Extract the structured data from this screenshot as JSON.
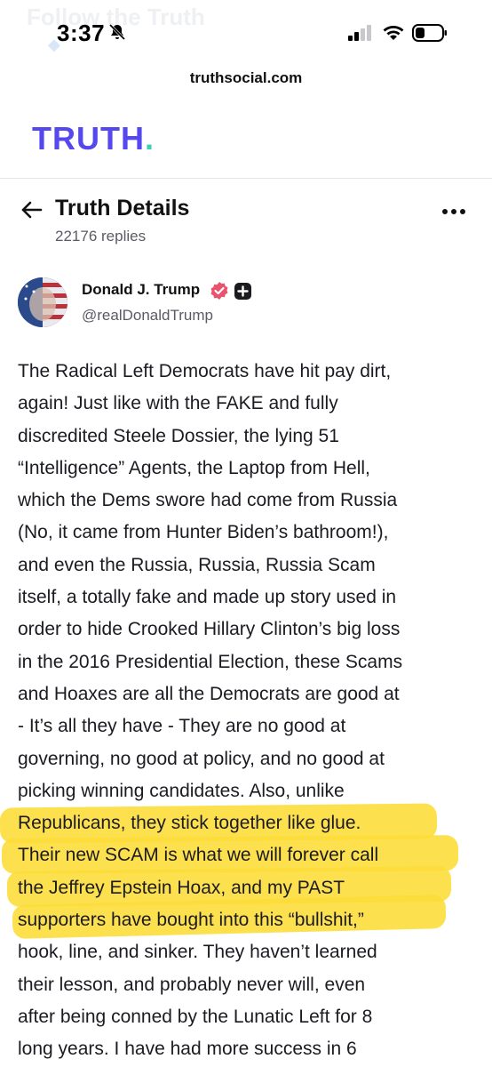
{
  "status_bar": {
    "time": "3:37",
    "ghost_title": "Follow the Truth",
    "url": "truthsocial.com"
  },
  "brand": {
    "logo_text": "TRUTH",
    "logo_dot": ".",
    "logo_color": "#5448ee",
    "dot_color": "#3fcdb4"
  },
  "header": {
    "title": "Truth Details",
    "replies": "22176 replies"
  },
  "author": {
    "name": "Donald J. Trump",
    "handle": "@realDonaldTrump"
  },
  "post": {
    "highlight_color": "#fddd3b",
    "lines": [
      "The Radical Left Democrats have hit pay dirt,",
      "again! Just like with the FAKE and fully",
      "discredited Steele Dossier, the lying 51",
      "“Intelligence” Agents, the Laptop from Hell,",
      "which the Dems swore had come from Russia",
      "(No, it came from Hunter Biden’s bathroom!),",
      "and even the Russia, Russia, Russia Scam",
      "itself, a totally fake and made up story used in",
      "order to hide Crooked Hillary Clinton’s big loss",
      "in the 2016 Presidential Election, these Scams",
      "and Hoaxes are all the Democrats are good at",
      "- It’s all they have - They are no good at",
      "governing, no good at policy, and no good at",
      "picking winning candidates. Also, unlike",
      "Republicans, they stick together like glue.",
      "Their new SCAM is what we will forever call",
      "the Jeffrey Epstein Hoax, and my PAST",
      "supporters have bought into this “bullshit,”",
      "hook, line, and sinker. They haven’t learned",
      "their lesson, and probably never will, even",
      "after being conned by the Lunatic Left for 8",
      "long years. I have had more success in 6"
    ]
  }
}
